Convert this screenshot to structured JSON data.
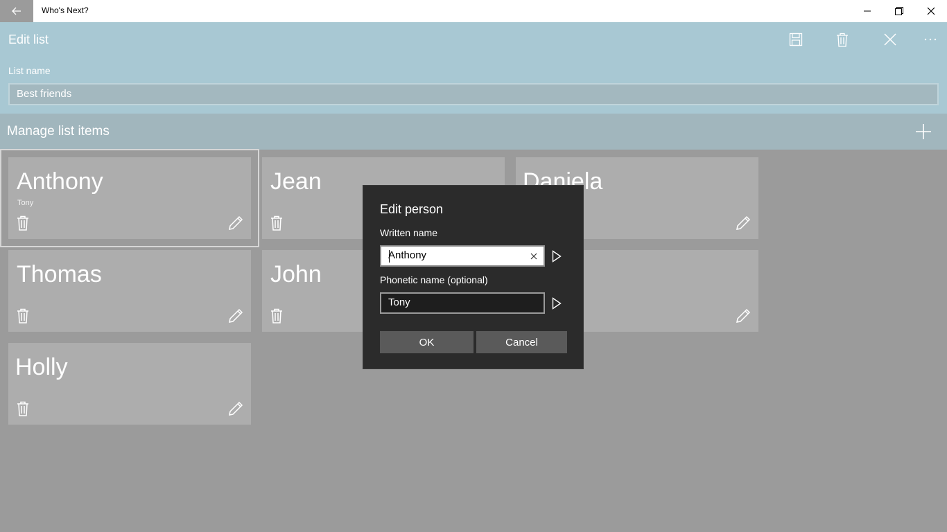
{
  "window": {
    "title": "Who's Next?"
  },
  "header": {
    "title": "Edit list",
    "list_name_label": "List name",
    "list_name_value": "Best friends"
  },
  "manage": {
    "title": "Manage list items"
  },
  "cards": [
    {
      "name": "Anthony",
      "phonetic": "Tony"
    },
    {
      "name": "Jean",
      "phonetic": ""
    },
    {
      "name": "Daniela",
      "phonetic": ""
    },
    {
      "name": "Thomas",
      "phonetic": ""
    },
    {
      "name": "John",
      "phonetic": ""
    },
    {
      "name": "",
      "phonetic": ""
    },
    {
      "name": "Holly",
      "phonetic": ""
    }
  ],
  "dialog": {
    "title": "Edit person",
    "written_label": "Written name",
    "written_value": "Anthony",
    "phonetic_label": "Phonetic name (optional)",
    "phonetic_value": "Tony",
    "ok_label": "OK",
    "cancel_label": "Cancel"
  },
  "colors": {
    "header_bg": "#a8c8d3",
    "dialog_bg": "#2b2b2b",
    "card_bg": "#adadad"
  }
}
